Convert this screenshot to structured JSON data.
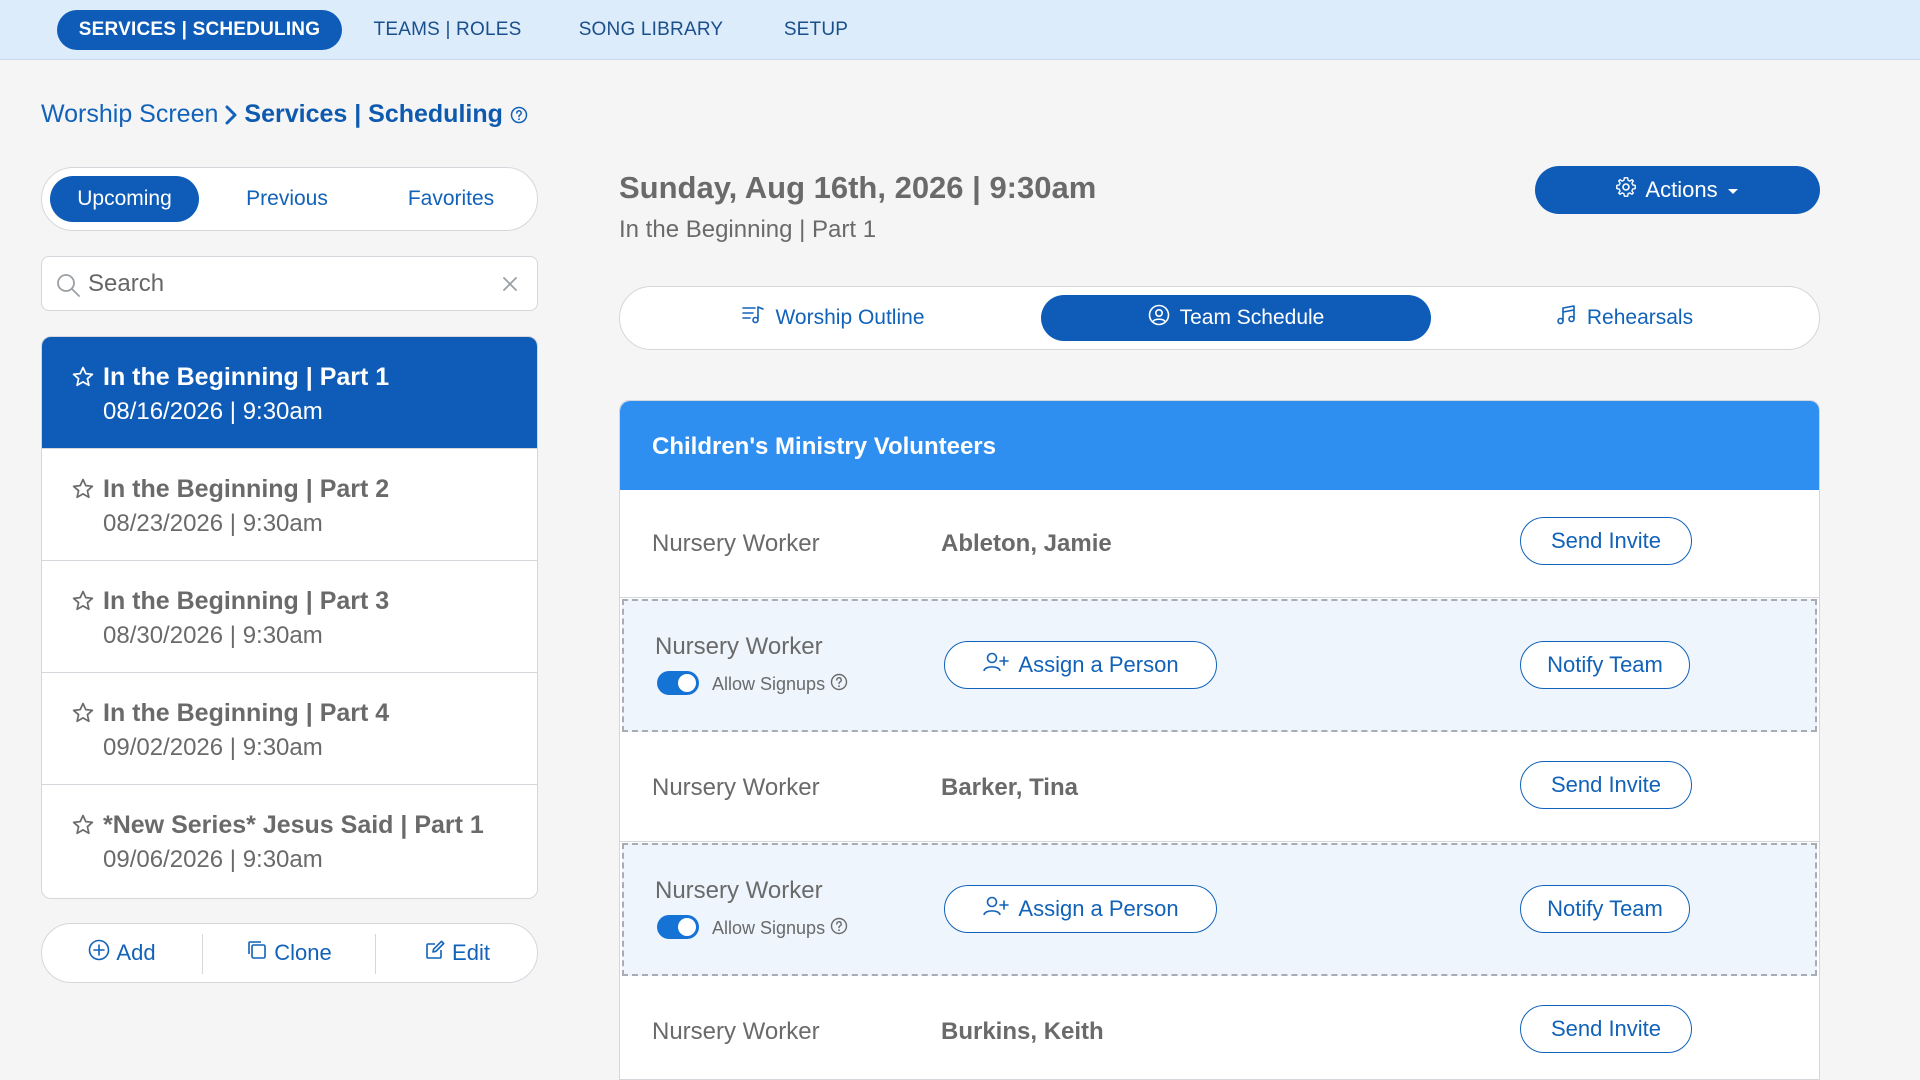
{
  "topnav": {
    "items": [
      {
        "label": "SERVICES | SCHEDULING",
        "active": true
      },
      {
        "label": "TEAMS | ROLES",
        "active": false
      },
      {
        "label": "SONG LIBRARY",
        "active": false
      },
      {
        "label": "SETUP",
        "active": false
      }
    ]
  },
  "breadcrumb": {
    "root": "Worship Screen",
    "current": "Services | Scheduling"
  },
  "filters": {
    "upcoming": "Upcoming",
    "previous": "Previous",
    "favorites": "Favorites",
    "selected": "Upcoming"
  },
  "search": {
    "placeholder": "Search",
    "value": ""
  },
  "services": [
    {
      "title": "In the Beginning | Part 1",
      "date": "08/16/2026 | 9:30am",
      "active": true
    },
    {
      "title": "In the Beginning | Part 2",
      "date": "08/23/2026 | 9:30am",
      "active": false
    },
    {
      "title": "In the Beginning | Part 3",
      "date": "08/30/2026 | 9:30am",
      "active": false
    },
    {
      "title": "In the Beginning | Part 4",
      "date": "09/02/2026 | 9:30am",
      "active": false
    },
    {
      "title": "*New Series* Jesus Said | Part 1",
      "date": "09/06/2026 | 9:30am",
      "active": false
    }
  ],
  "list_actions": {
    "add": "Add",
    "clone": "Clone",
    "edit": "Edit"
  },
  "service_detail": {
    "heading": "Sunday, Aug 16th, 2026 | 9:30am",
    "subheading": "In the Beginning | Part 1",
    "actions_label": "Actions"
  },
  "tabs": {
    "outline": "Worship Outline",
    "team": "Team Schedule",
    "rehearsals": "Rehearsals",
    "selected": "Team Schedule"
  },
  "team": {
    "name": "Children's Ministry Volunteers",
    "rows": [
      {
        "role": "Nursery Worker",
        "person": "Ableton, Jamie",
        "action": "Send Invite"
      },
      {
        "role": "Nursery Worker",
        "allow_signups": "Allow Signups",
        "signups_on": true,
        "assign": "Assign a Person",
        "action": "Notify Team"
      },
      {
        "role": "Nursery Worker",
        "person": "Barker, Tina",
        "action": "Send Invite"
      },
      {
        "role": "Nursery Worker",
        "allow_signups": "Allow Signups",
        "signups_on": true,
        "assign": "Assign a Person",
        "action": "Notify Team"
      },
      {
        "role": "Nursery Worker",
        "person": "Burkins, Keith",
        "action": "Send Invite"
      }
    ]
  },
  "colors": {
    "primary": "#0e5cb7",
    "team_header": "#2f8ff0",
    "nav_bg": "#dcecfb",
    "text_gray": "#6a6a6a"
  }
}
